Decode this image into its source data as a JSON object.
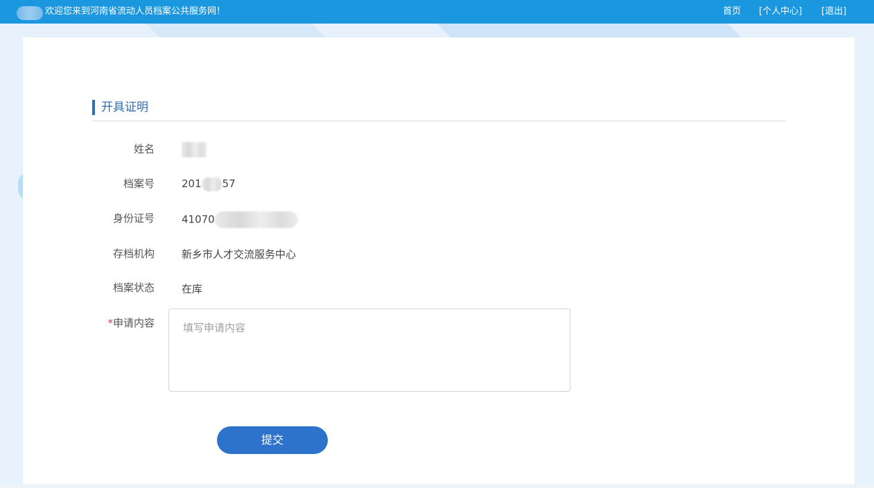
{
  "header": {
    "welcome_text": "欢迎您来到河南省流动人员档案公共服务网！",
    "nav": [
      {
        "label": "首页"
      },
      {
        "label": "[个人中心]"
      },
      {
        "label": "[退出]"
      }
    ]
  },
  "section": {
    "title": "开具证明"
  },
  "form": {
    "fields": [
      {
        "label": "姓名",
        "value": ""
      },
      {
        "label": "档案号",
        "value_prefix": "201",
        "value_suffix": "57"
      },
      {
        "label": "身份证号",
        "value_prefix": "41070"
      },
      {
        "label": "存档机构",
        "value": "新乡市人才交流服务中心"
      },
      {
        "label": "档案状态",
        "value": "在库"
      }
    ],
    "request": {
      "required_mark": "*",
      "label": "申请内容",
      "placeholder": "填写申请内容",
      "value": ""
    },
    "submit_label": "提交"
  },
  "colors": {
    "topbar": "#1b97e0",
    "accent": "#2f6fb7",
    "button": "#2d72cb",
    "required": "#e2383e"
  }
}
